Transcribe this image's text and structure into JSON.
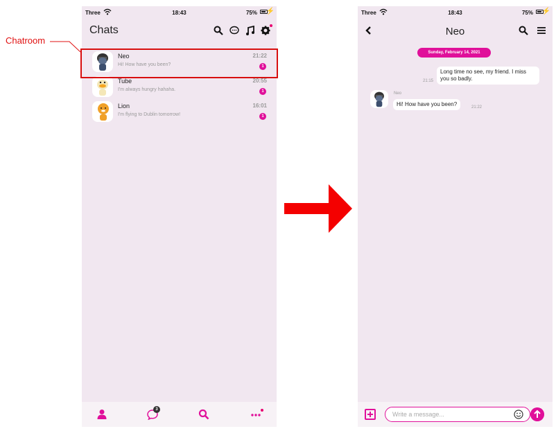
{
  "status_bar": {
    "carrier": "Three",
    "time": "18:43",
    "battery": "75%"
  },
  "annotation": {
    "label": "Chatroom"
  },
  "chat_list": {
    "title": "Chats",
    "header_icons": [
      "search-icon",
      "chat-bubble-icon",
      "music-note-icon",
      "gear-icon"
    ],
    "chats": [
      {
        "name": "Neo",
        "preview": "Hi! How have you been?",
        "time": "21:22",
        "unread": "1"
      },
      {
        "name": "Tube",
        "preview": "I'm always hungry hahaha.",
        "time": "20:55",
        "unread": "1"
      },
      {
        "name": "Lion",
        "preview": "I'm flying to Dublin tomorrow!",
        "time": "16:01",
        "unread": "1"
      }
    ],
    "tab_bar": {
      "tabs": [
        "person-icon",
        "chat-bubble-icon",
        "search-icon",
        "more-icon"
      ],
      "chat_badge": "3"
    }
  },
  "chat_room": {
    "title": "Neo",
    "date_label": "Sunday, February 14, 2021",
    "messages": [
      {
        "from": "me",
        "text": "Long time no see, my friend. I miss you so badly.",
        "time": "21:15"
      },
      {
        "from": "Neo",
        "sender": "Neo",
        "text": "Hi! How have you been?",
        "time": "21:22"
      }
    ],
    "composer": {
      "placeholder": "Write a message..."
    }
  },
  "colors": {
    "accent": "#e0109a",
    "annotation": "#e01010",
    "background": "#f1e7f0"
  }
}
